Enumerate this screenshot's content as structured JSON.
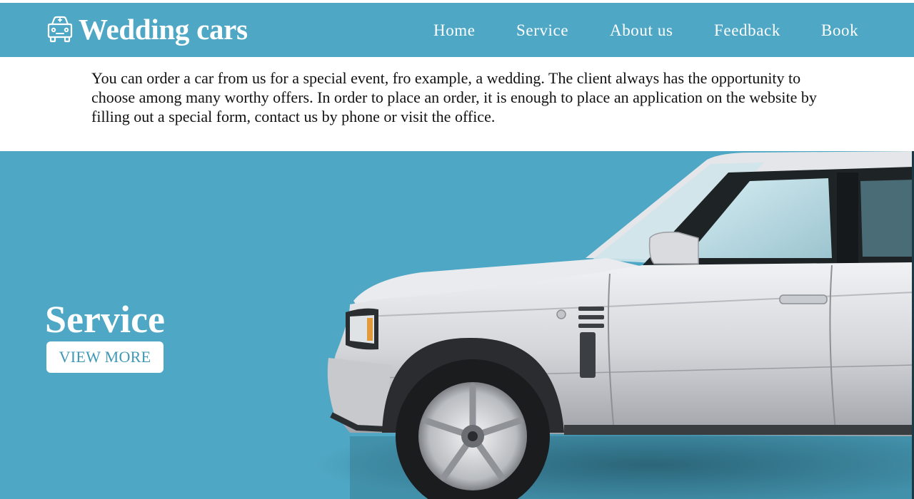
{
  "brand": {
    "title": "Wedding cars",
    "icon": "car-icon"
  },
  "nav": {
    "items": [
      "Home",
      "Service",
      "About us",
      "Feedback",
      "Book"
    ]
  },
  "intro": {
    "text": "You can order a car from us for a special event, fro example, a wedding. The client always has the opportunity to choose among many worthy offers. In order to place an order, it is enough to place an application on the website by filling out a special form, contact us by phone or visit the office."
  },
  "hero": {
    "title": "Service",
    "button": "VIEW MORE",
    "image": "silver-suv-car-image"
  },
  "colors": {
    "accent": "#4ea7c4",
    "button_text": "#3f98b6",
    "text": "#111111",
    "white": "#ffffff"
  }
}
